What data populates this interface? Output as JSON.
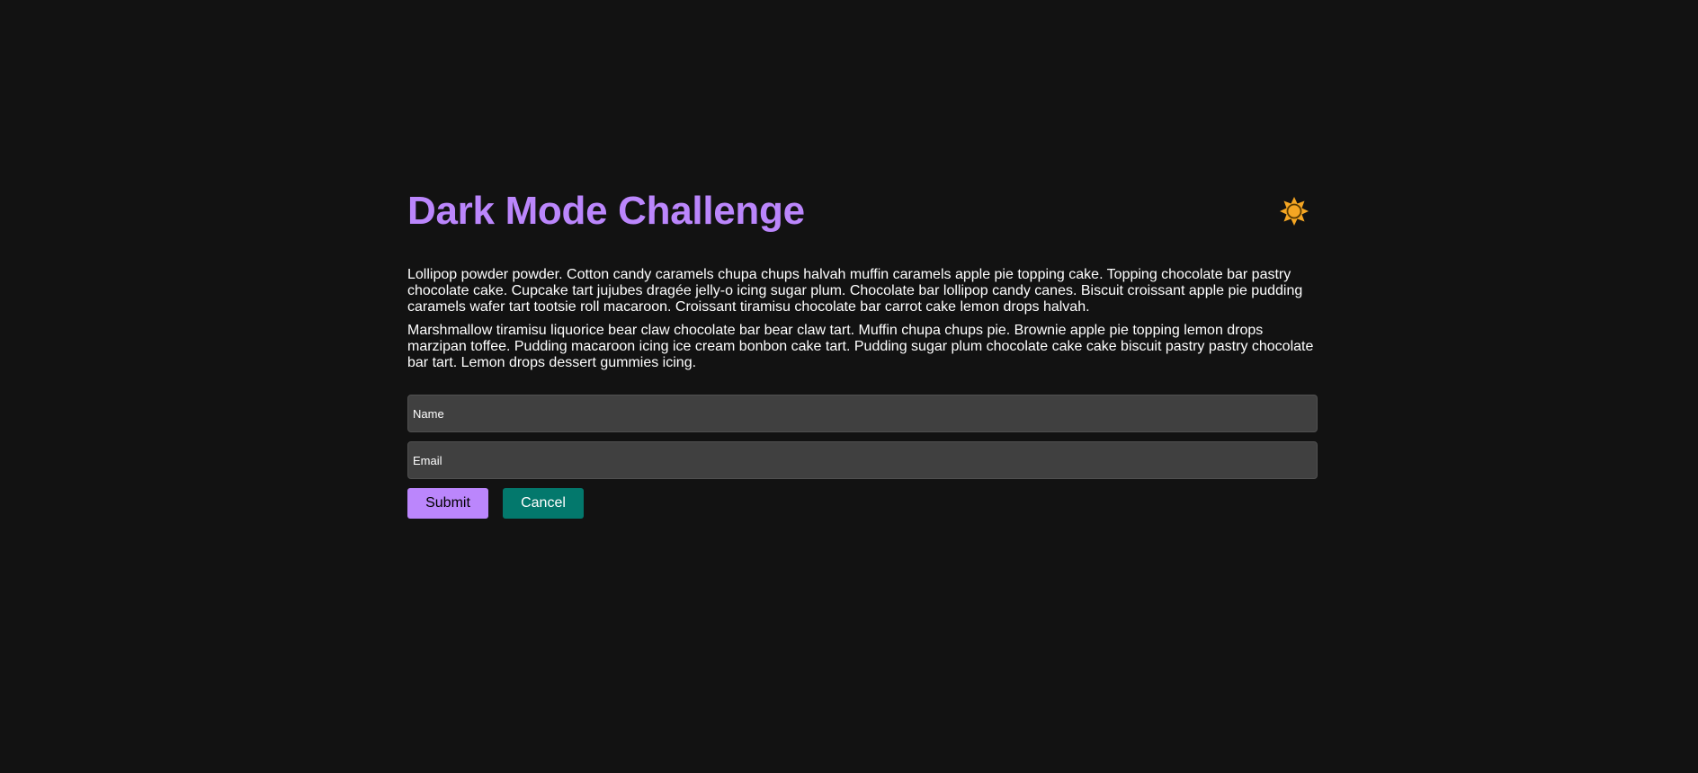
{
  "page": {
    "title": "Dark Mode Challenge",
    "theme_toggle_icon": "sun-icon"
  },
  "content": {
    "paragraphs": [
      "Lollipop powder powder. Cotton candy caramels chupa chups halvah muffin caramels apple pie topping cake. Topping chocolate bar pastry chocolate cake. Cupcake tart jujubes dragée jelly-o icing sugar plum. Chocolate bar lollipop candy canes. Biscuit croissant apple pie pudding caramels wafer tart tootsie roll macaroon. Croissant tiramisu chocolate bar carrot cake lemon drops halvah.",
      "Marshmallow tiramisu liquorice bear claw chocolate bar bear claw tart. Muffin chupa chups pie. Brownie apple pie topping lemon drops marzipan toffee. Pudding macaroon icing ice cream bonbon cake tart. Pudding sugar plum chocolate cake cake biscuit pastry pastry chocolate bar tart. Lemon drops dessert gummies icing."
    ]
  },
  "form": {
    "name_placeholder": "Name",
    "name_value": "",
    "email_placeholder": "Email",
    "email_value": "",
    "submit_label": "Submit",
    "cancel_label": "Cancel"
  },
  "colors": {
    "background": "#121212",
    "accent": "#bb86fc",
    "secondary": "#03786c",
    "input_background": "#404040",
    "sun": "#f5a623"
  }
}
